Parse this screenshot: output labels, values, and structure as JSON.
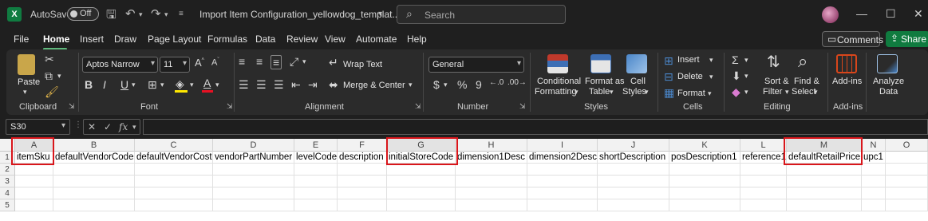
{
  "titlebar": {
    "app_logo": "X",
    "autosave_label": "AutoSave",
    "autosave_state": "Off",
    "document_title": "Import Item Configuration_yellowdog_templat...",
    "search_placeholder": "Search"
  },
  "menu": {
    "tabs": [
      "File",
      "Home",
      "Insert",
      "Draw",
      "Page Layout",
      "Formulas",
      "Data",
      "Review",
      "View",
      "Automate",
      "Help"
    ],
    "active_tab": "Home",
    "comments_label": "Comments",
    "share_label": "Share"
  },
  "ribbon": {
    "clipboard": {
      "paste_label": "Paste",
      "group_label": "Clipboard"
    },
    "font": {
      "font_name": "Aptos Narrow",
      "font_size": "11",
      "group_label": "Font",
      "fill_color": "#ffe800",
      "font_color": "#e81123"
    },
    "alignment": {
      "wrap_text_label": "Wrap Text",
      "merge_center_label": "Merge & Center",
      "group_label": "Alignment"
    },
    "number": {
      "format_value": "General",
      "group_label": "Number"
    },
    "styles": {
      "conditional_formatting_label": [
        "Conditional",
        "Formatting"
      ],
      "format_as_table_label": [
        "Format as",
        "Table"
      ],
      "cell_styles_label": [
        "Cell",
        "Styles"
      ],
      "group_label": "Styles"
    },
    "cells": {
      "insert_label": "Insert",
      "delete_label": "Delete",
      "format_label": "Format",
      "group_label": "Cells"
    },
    "editing": {
      "sort_filter_label": [
        "Sort &",
        "Filter"
      ],
      "find_select_label": [
        "Find &",
        "Select"
      ],
      "group_label": "Editing"
    },
    "addins": {
      "addins_label": "Add-ins",
      "group_label": "Add-ins"
    },
    "analyze": {
      "label": [
        "Analyze",
        "Data"
      ]
    }
  },
  "formula_bar": {
    "name_box": "S30",
    "formula_value": ""
  },
  "sheet": {
    "columns": [
      "A",
      "B",
      "C",
      "D",
      "E",
      "F",
      "G",
      "H",
      "I",
      "J",
      "K",
      "L",
      "M",
      "N",
      "O"
    ],
    "rows": [
      "1",
      "2",
      "3",
      "4",
      "5"
    ],
    "header_row": [
      "itemSku",
      "defaultVendorCode",
      "defaultVendorCost",
      "vendorPartNumber",
      "levelCode",
      "description",
      "initialStoreCode",
      "dimension1Desc",
      "dimension2Desc",
      "shortDescription",
      "posDescription1",
      "reference1",
      "defaultRetailPrice",
      "upc1",
      ""
    ],
    "highlighted_columns": [
      "A",
      "G",
      "M"
    ],
    "highlight_color": "#d9161b"
  }
}
